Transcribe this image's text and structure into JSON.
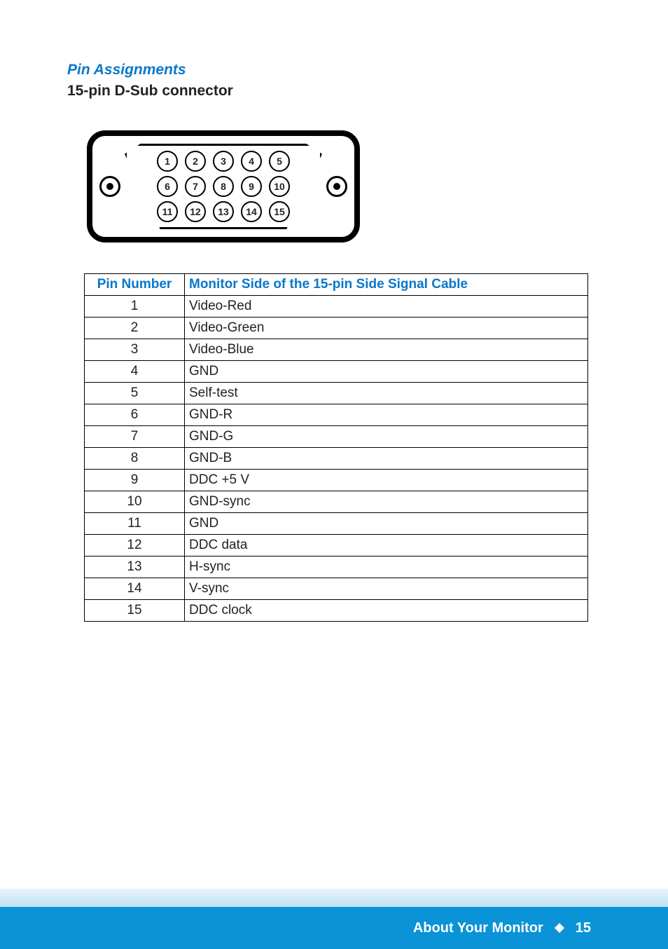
{
  "section_title": "Pin Assignments",
  "subtitle": "15-pin D-Sub connector",
  "connector_pins": {
    "row1": [
      "1",
      "2",
      "3",
      "4",
      "5"
    ],
    "row2": [
      "6",
      "7",
      "8",
      "9",
      "10"
    ],
    "row3": [
      "11",
      "12",
      "13",
      "14",
      "15"
    ]
  },
  "table": {
    "headers": {
      "pin": "Pin Number",
      "signal": "Monitor Side of the 15-pin Side Signal Cable"
    },
    "rows": [
      {
        "pin": "1",
        "signal": "Video-Red"
      },
      {
        "pin": "2",
        "signal": "Video-Green"
      },
      {
        "pin": "3",
        "signal": "Video-Blue"
      },
      {
        "pin": "4",
        "signal": "GND"
      },
      {
        "pin": "5",
        "signal": "Self-test"
      },
      {
        "pin": "6",
        "signal": "GND-R"
      },
      {
        "pin": "7",
        "signal": "GND-G"
      },
      {
        "pin": "8",
        "signal": "GND-B"
      },
      {
        "pin": "9",
        "signal": "DDC +5 V"
      },
      {
        "pin": "10",
        "signal": "GND-sync"
      },
      {
        "pin": "11",
        "signal": "GND"
      },
      {
        "pin": "12",
        "signal": "DDC data"
      },
      {
        "pin": "13",
        "signal": "H-sync"
      },
      {
        "pin": "14",
        "signal": "V-sync"
      },
      {
        "pin": "15",
        "signal": "DDC clock"
      }
    ]
  },
  "footer": {
    "chapter": "About Your Monitor",
    "page": "15"
  }
}
